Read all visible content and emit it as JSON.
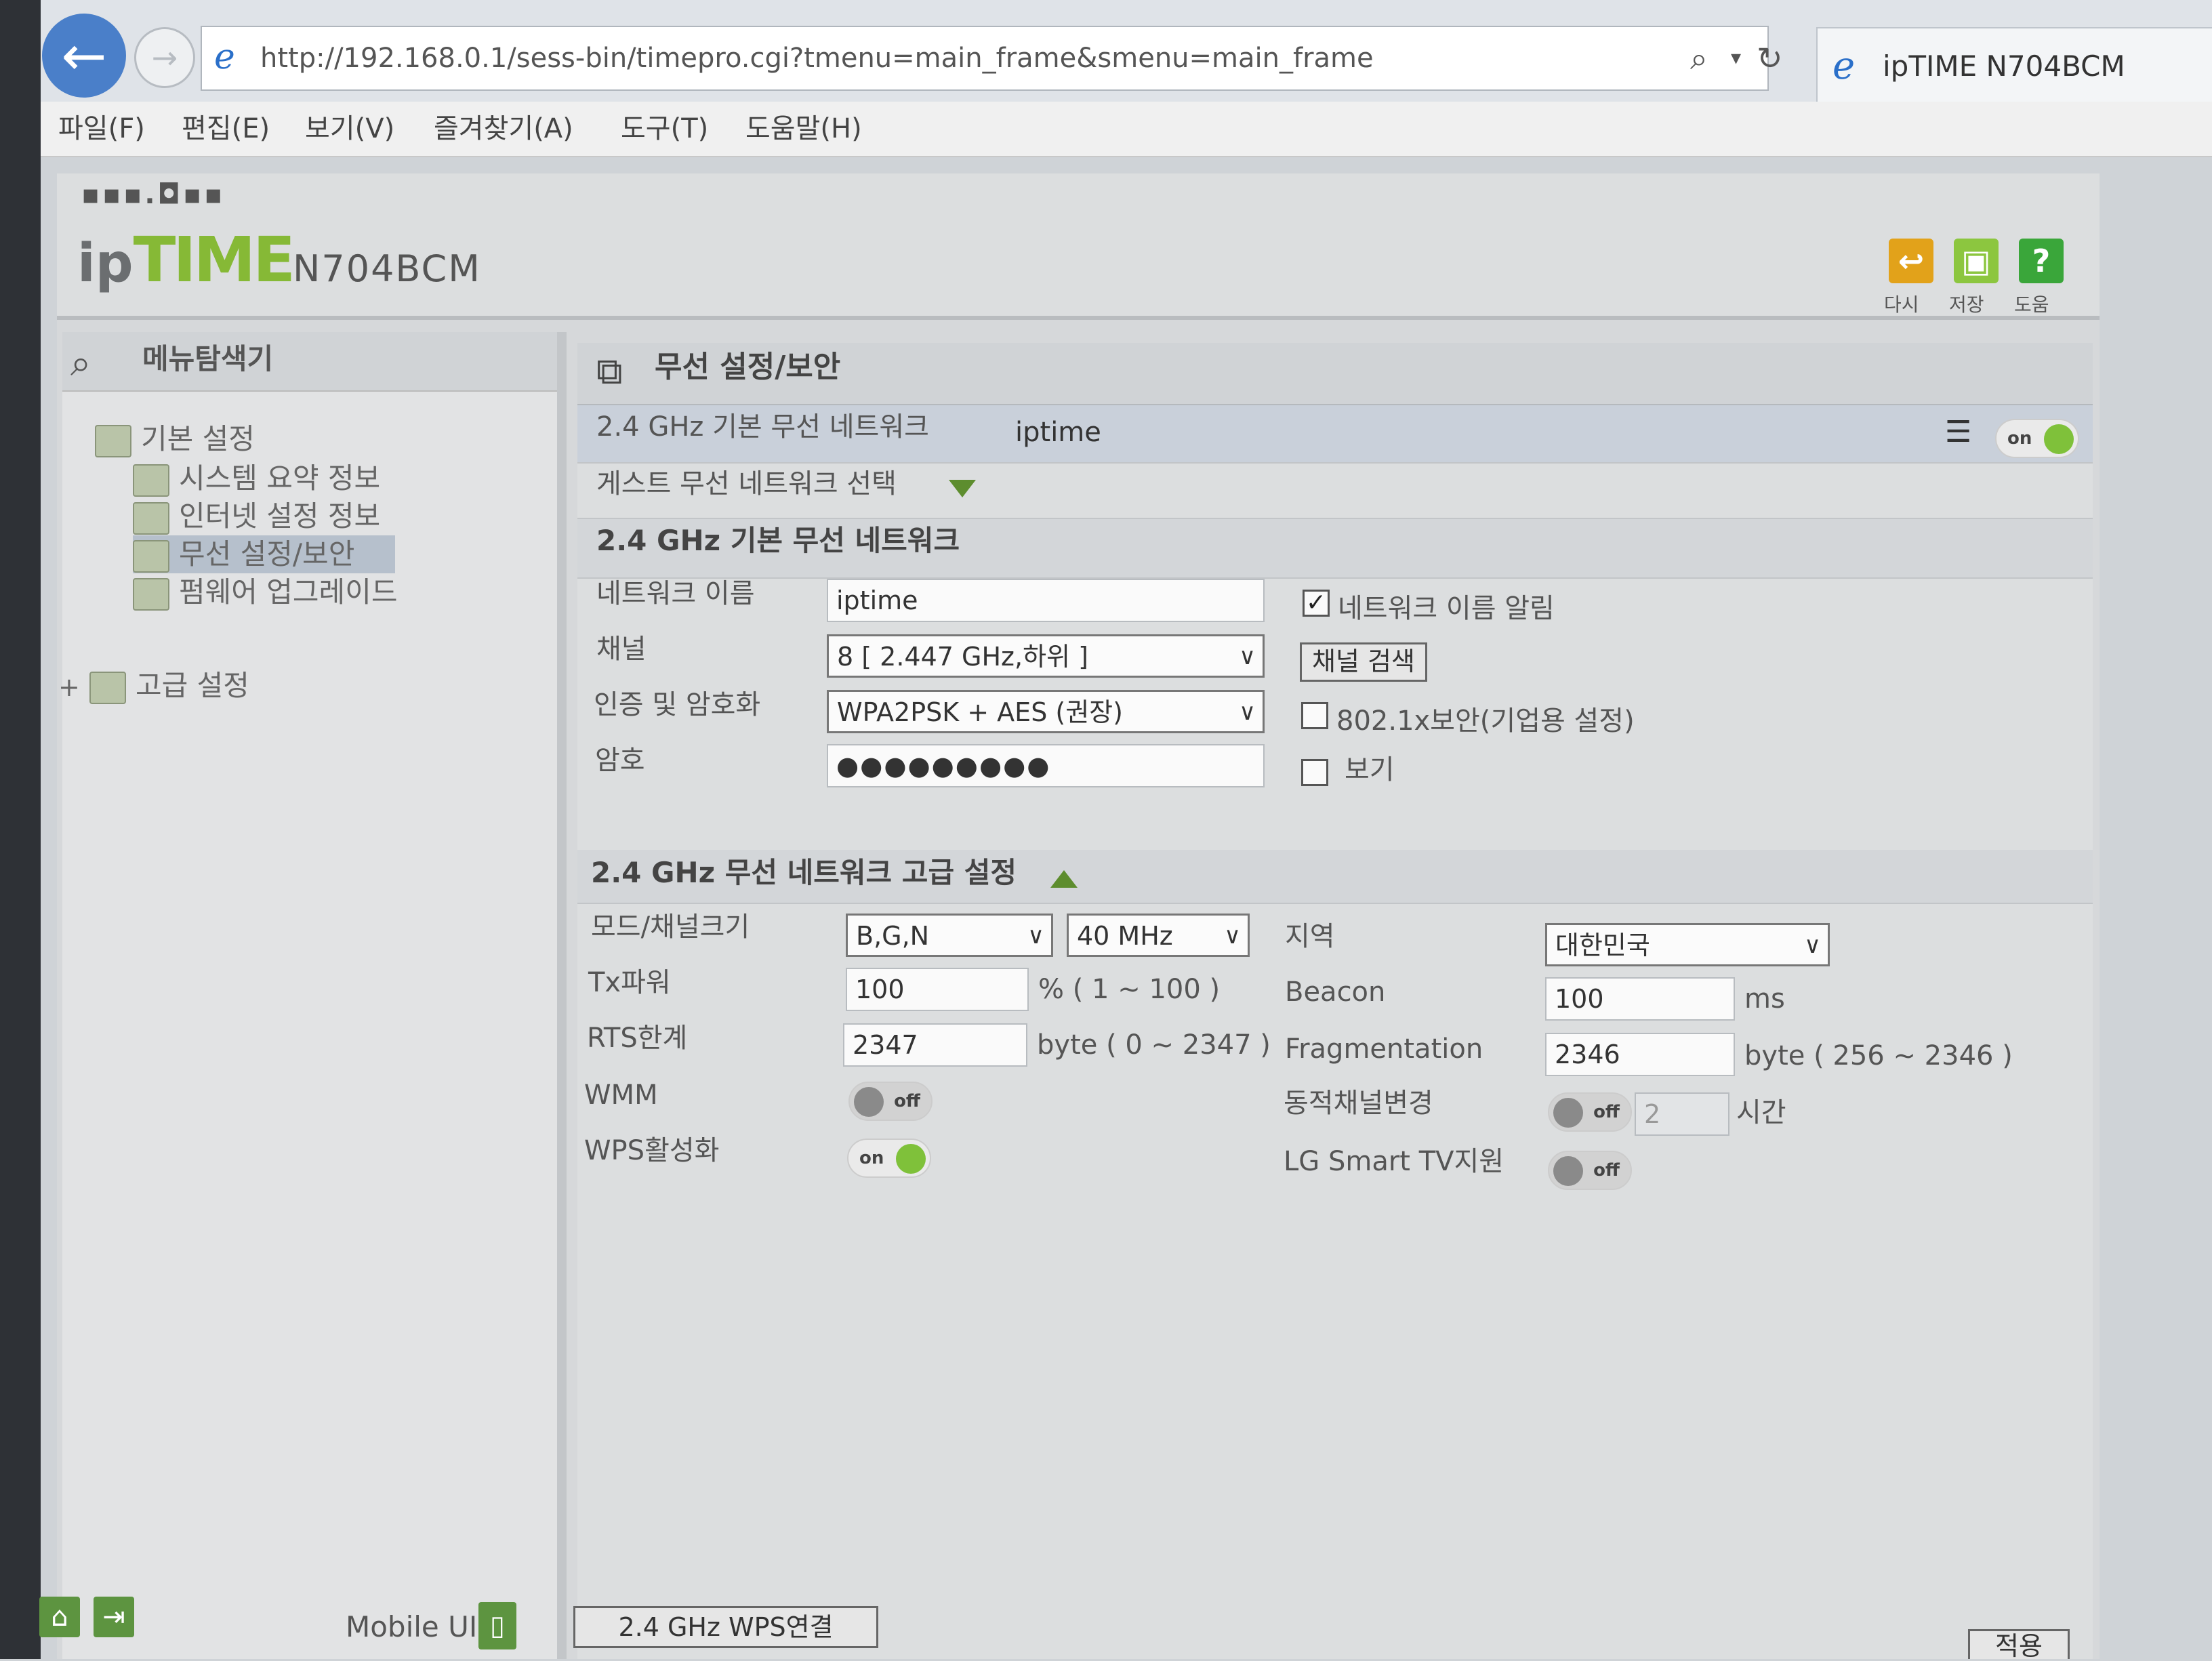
{
  "browser": {
    "url": "http://192.168.0.1/sess-bin/timepro.cgi?tmenu=main_frame&smenu=main_frame",
    "tab_title": "ipTIME N704BCM",
    "menu": [
      "파일(F)",
      "편집(E)",
      "보기(V)",
      "즐겨찾기(A)",
      "도구(T)",
      "도움말(H)"
    ]
  },
  "header": {
    "logo_prefix": "ip",
    "logo_mark": "TIME",
    "logo_model": "N704BCM",
    "buttons": [
      {
        "label": "다시",
        "color": "#e2a21a"
      },
      {
        "label": "저장",
        "color": "#8cc63f"
      },
      {
        "label": "도움",
        "color": "#3aa63a"
      }
    ]
  },
  "sidebar": {
    "title": "메뉴탐색기",
    "basic": "기본 설정",
    "items": [
      "시스템 요약 정보",
      "인터넷 설정 정보",
      "무선 설정/보안",
      "펌웨어 업그레이드"
    ],
    "advanced": "고급 설정",
    "mobile_label": "Mobile UI"
  },
  "main": {
    "title": "무선 설정/보안",
    "network_row": {
      "label": "2.4 GHz 기본 무선 네트워크",
      "ssid": "iptime",
      "toggle": "on"
    },
    "guest_row": {
      "label": "게스트 무선 네트워크 선택"
    },
    "basic_section": {
      "title": "2.4 GHz 기본 무선 네트워크",
      "network_name_label": "네트워크 이름",
      "network_name_value": "iptime",
      "broadcast_label": "네트워크 이름 알림",
      "broadcast_checked": true,
      "channel_label": "채널",
      "channel_value": "8 [ 2.447 GHz,하위 ]",
      "channel_search_button": "채널 검색",
      "auth_label": "인증 및 암호화",
      "auth_value": "WPA2PSK + AES (권장)",
      "enterprise_label": "802.1x보안(기업용 설정)",
      "enterprise_checked": false,
      "password_label": "암호",
      "password_value": "●●●●●●●●●",
      "show_label": "보기",
      "show_checked": false
    },
    "advanced_section": {
      "title": "2.4 GHz 무선 네트워크 고급 설정",
      "mode_label": "모드/채널크기",
      "mode_value": "B,G,N",
      "width_value": "40 MHz",
      "region_label": "지역",
      "region_value": "대한민국",
      "tx_label": "Tx파워",
      "tx_value": "100",
      "tx_unit": "% ( 1 ~ 100 )",
      "beacon_label": "Beacon",
      "beacon_value": "100",
      "beacon_unit": "ms",
      "rts_label": "RTS한계",
      "rts_value": "2347",
      "rts_unit": "byte ( 0 ~ 2347 )",
      "frag_label": "Fragmentation",
      "frag_value": "2346",
      "frag_unit": "byte ( 256 ~ 2346 )",
      "wmm_label": "WMM",
      "wmm_toggle": "off",
      "dyn_label": "동적채널변경",
      "dyn_toggle": "off",
      "dyn_value": "2",
      "dyn_unit": "시간",
      "wps_label": "WPS활성화",
      "wps_toggle": "on",
      "lg_label": "LG Smart TV지원",
      "lg_toggle": "off"
    },
    "wps_button": "2.4 GHz WPS연결",
    "apply_button": "적용"
  }
}
